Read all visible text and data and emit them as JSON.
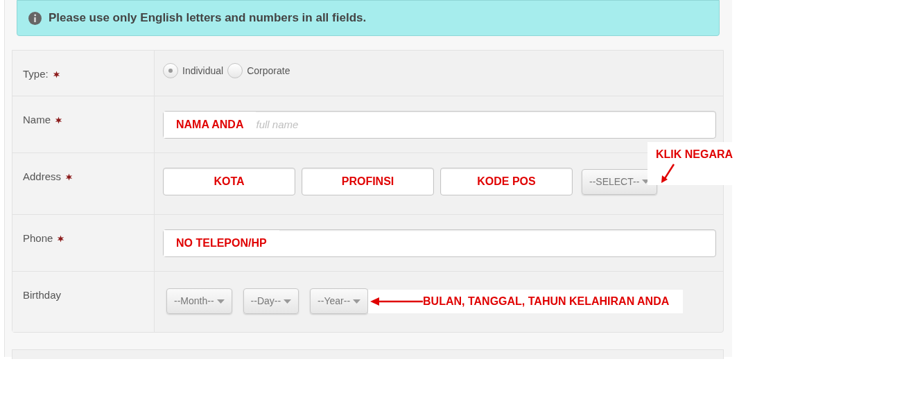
{
  "notice": {
    "text": "Please use only English letters and numbers in all fields."
  },
  "fields": [
    {
      "kind": "radio",
      "label": "Type:",
      "required": true,
      "options": [
        {
          "label": "Individual",
          "selected": true
        },
        {
          "label": "Corporate",
          "selected": false
        }
      ]
    },
    {
      "kind": "text",
      "label": "Name",
      "required": true,
      "annotation": "NAMA ANDA",
      "placeholder": "full name"
    },
    {
      "kind": "address",
      "label": "Address",
      "required": true,
      "inputs": [
        {
          "annotation": "KOTA"
        },
        {
          "annotation": "PROFINSI"
        },
        {
          "annotation": "KODE POS"
        }
      ],
      "select": "--SELECT--",
      "callout": "KLIK NEGARA"
    },
    {
      "kind": "text",
      "label": "Phone",
      "required": true,
      "annotation": "NO TELEPON/HP"
    },
    {
      "kind": "date",
      "label": "Birthday",
      "required": false,
      "selects": [
        "--Month--",
        "--Day--",
        "--Year--"
      ],
      "callout": "BULAN, TANGGAL, TAHUN KELAHIRAN ANDA"
    }
  ]
}
